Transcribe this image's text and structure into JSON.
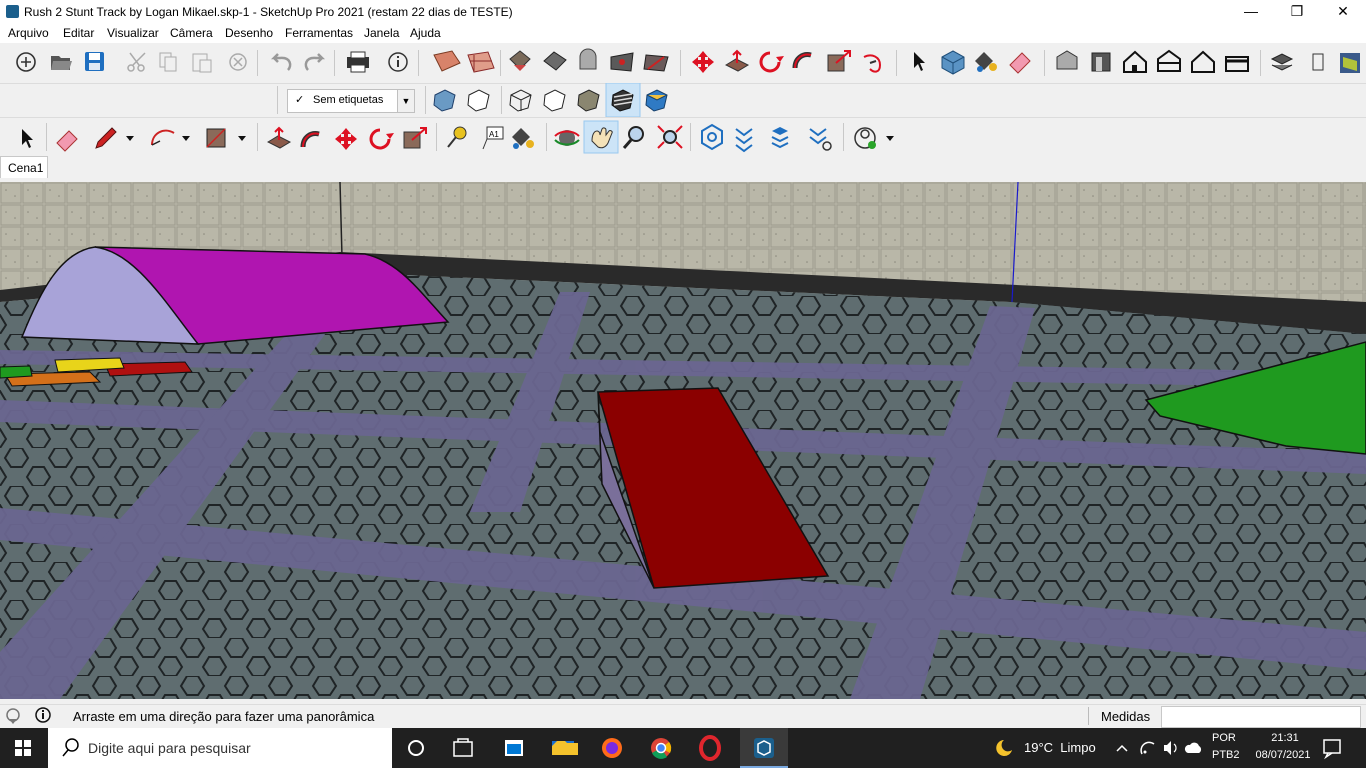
{
  "window": {
    "title": "Rush 2 Stunt Track by Logan Mikael.skp-1 - SketchUp Pro 2021 (restam 22 dias de TESTE)",
    "minimize_glyph": "—",
    "maximize_glyph": "❐",
    "close_glyph": "✕"
  },
  "menu": [
    "Arquivo",
    "Editar",
    "Visualizar",
    "Câmera",
    "Desenho",
    "Ferramentas",
    "Janela",
    "Ajuda"
  ],
  "tags": {
    "check": "✓",
    "label": "Sem etiquetas",
    "arrow": "▼"
  },
  "toolbar_icons": {
    "row1": [
      "new-icon",
      "open-icon",
      "save-icon",
      "cut-icon",
      "copy-icon",
      "paste-icon",
      "erase-icon",
      "undo-icon",
      "redo-icon",
      "print-icon",
      "model-info-icon",
      "paint-icon",
      "section-icon",
      "component-icon",
      "group-icon",
      "solid-icon",
      "solid-union-icon",
      "solid-trim-icon",
      "move-icon",
      "pushpull-icon",
      "rotate-icon",
      "followme-icon",
      "scale-icon",
      "offset-icon",
      "select-icon",
      "make-component-icon",
      "paint-bucket-icon",
      "eraser-icon",
      "iso-view-icon",
      "front-view-icon",
      "home-view-icon",
      "right-view-icon",
      "back-view-icon",
      "left-view-icon",
      "layers-icon",
      "extensions-icon",
      "warehouse-icon"
    ],
    "row2_styles": [
      "xray-icon",
      "back-edges-icon",
      "wireframe-icon",
      "hidden-line-icon",
      "shaded-icon",
      "shaded-texture-icon",
      "monochrome-icon"
    ],
    "row3": [
      "select-icon",
      "eraser-icon",
      "pencil-icon",
      "arc-icon",
      "rectangle-icon",
      "pushpull-icon",
      "followme-icon",
      "move-icon",
      "rotate-icon",
      "scale-icon",
      "tape-measure-icon",
      "text-icon",
      "paint-bucket-icon",
      "orbit-icon",
      "pan-icon",
      "zoom-icon",
      "zoom-extents-icon",
      "sandbox-icon",
      "stamp-icon",
      "drape-icon",
      "add-detail-icon",
      "account-icon"
    ]
  },
  "colors": {
    "accent": "#1b5f8c",
    "ramp_red": "#8b0000",
    "ramp_magenta": "#b015b0",
    "ramp_lavender": "#a8a3d8",
    "ramp_green": "#1f9a1f",
    "floor": "#5f6d70",
    "road": "#6a6690",
    "wall": "#b9b7a8"
  },
  "scene": {
    "tab": "Cena1"
  },
  "status": {
    "hint": "Arraste em uma direção para fazer uma panorâmica",
    "measure_label": "Medidas",
    "measure_value": ""
  },
  "taskbar": {
    "search_placeholder": "Digite aqui para pesquisar",
    "weather": "19°C  Limpo",
    "lang_top": "POR",
    "lang_bottom": "PTB2",
    "time": "21:31",
    "date": "08/07/2021",
    "apps": [
      "task-view-icon",
      "store-icon",
      "mail-icon",
      "file-explorer-icon",
      "firefox-icon",
      "chrome-icon",
      "opera-icon",
      "sketchup-icon"
    ]
  }
}
